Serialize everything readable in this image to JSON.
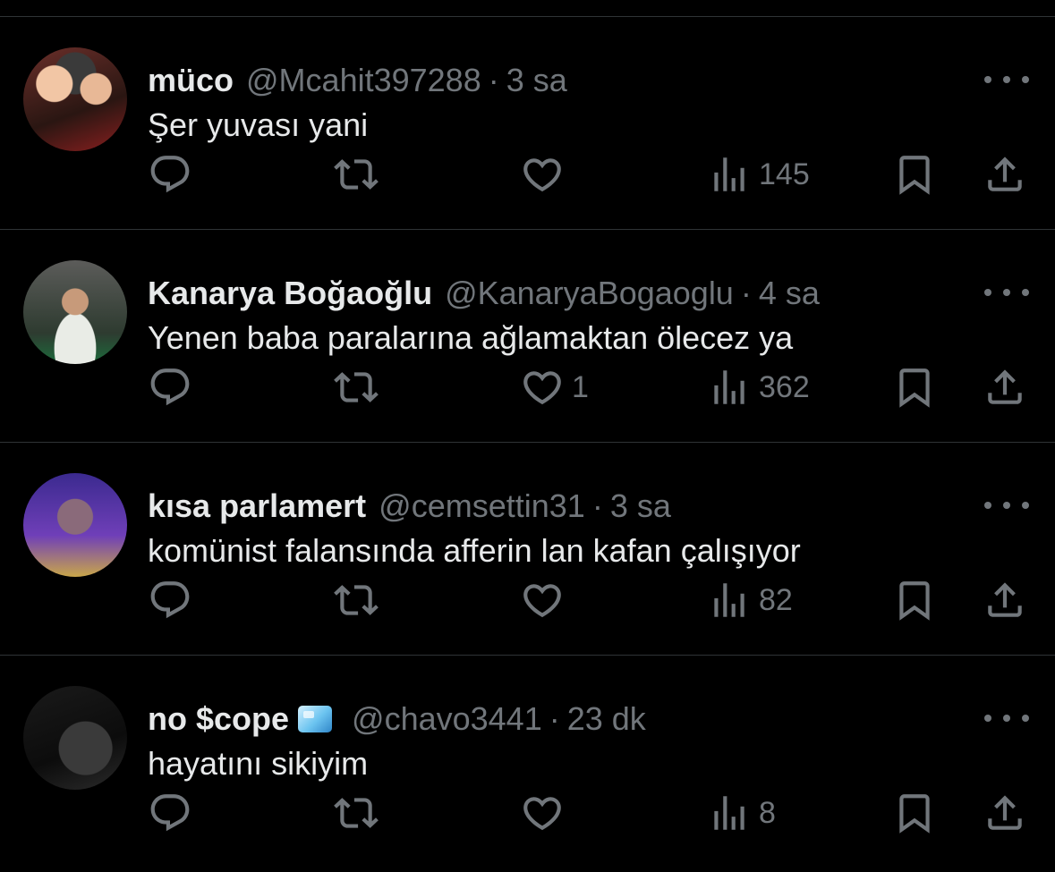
{
  "tweets": [
    {
      "name": "müco",
      "handle": "@Mcahit397288",
      "time": "3 sa",
      "text": "Şer yuvası yani",
      "badge": false,
      "replies": "",
      "retweets": "",
      "likes": "",
      "views": "145"
    },
    {
      "name": "Kanarya Boğaoğlu",
      "handle": "@KanaryaBogaoglu",
      "time": "4 sa",
      "text": "Yenen baba paralarına ağlamaktan ölecez ya",
      "badge": false,
      "replies": "",
      "retweets": "",
      "likes": "1",
      "views": "362"
    },
    {
      "name": "kısa parlamert",
      "handle": "@cemsettin31",
      "time": "3 sa",
      "text": "komünist falansında afferin lan kafan çalışıyor",
      "badge": false,
      "replies": "",
      "retweets": "",
      "likes": "",
      "views": "82"
    },
    {
      "name": "no $cope",
      "handle": "@chavo3441",
      "time": "23 dk",
      "text": "hayatını sikiyim",
      "badge": true,
      "replies": "",
      "retweets": "",
      "likes": "",
      "views": "8"
    }
  ],
  "separator": "·",
  "icons": {
    "reply": "reply-icon",
    "retweet": "retweet-icon",
    "like": "heart-icon",
    "views": "views-icon",
    "bookmark": "bookmark-icon",
    "share": "share-icon",
    "more": "more-icon"
  },
  "colors": {
    "background": "#000000",
    "text_primary": "#e7e9ea",
    "text_secondary": "#71767b",
    "divider": "#2f3336"
  }
}
